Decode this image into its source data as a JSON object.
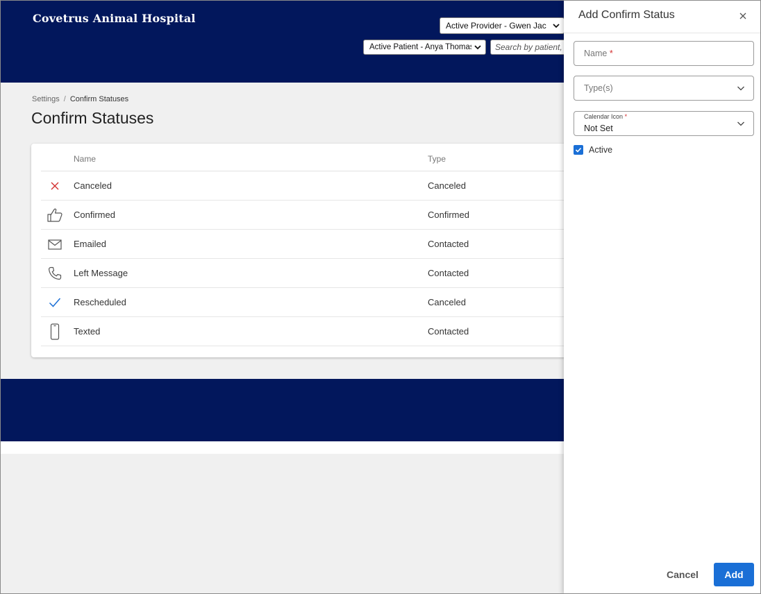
{
  "header": {
    "hospital_name": "Covetrus Animal Hospital",
    "provider_select": "Active Provider - Gwen Jac",
    "patient_select": "Active Patient - Anya Thomas",
    "search_placeholder": "Search by patient,"
  },
  "breadcrumb": {
    "parent": "Settings",
    "separator": "/",
    "current": "Confirm Statuses"
  },
  "page": {
    "title": "Confirm Statuses"
  },
  "table": {
    "headers": {
      "name": "Name",
      "type": "Type"
    },
    "rows": [
      {
        "icon": "x-icon",
        "name": "Canceled",
        "type": "Canceled"
      },
      {
        "icon": "thumbs-up-icon",
        "name": "Confirmed",
        "type": "Confirmed"
      },
      {
        "icon": "envelope-icon",
        "name": "Emailed",
        "type": "Contacted"
      },
      {
        "icon": "phone-icon",
        "name": "Left Message",
        "type": "Contacted"
      },
      {
        "icon": "checkmark-icon",
        "name": "Rescheduled",
        "type": "Canceled"
      },
      {
        "icon": "mobile-phone-icon",
        "name": "Texted",
        "type": "Contacted"
      }
    ]
  },
  "panel": {
    "title": "Add Confirm Status",
    "name_placeholder": "Name",
    "required_mark": "*",
    "types_placeholder": "Type(s)",
    "calendar_icon_label": "Calendar Icon",
    "calendar_icon_value": "Not Set",
    "active_label": "Active",
    "active_checked": true,
    "cancel_label": "Cancel",
    "add_label": "Add"
  },
  "colors": {
    "header_bg": "#02175c",
    "accent": "#1a6fd6",
    "cancel_x": "#d32f2f",
    "check": "#1a6fd6"
  }
}
